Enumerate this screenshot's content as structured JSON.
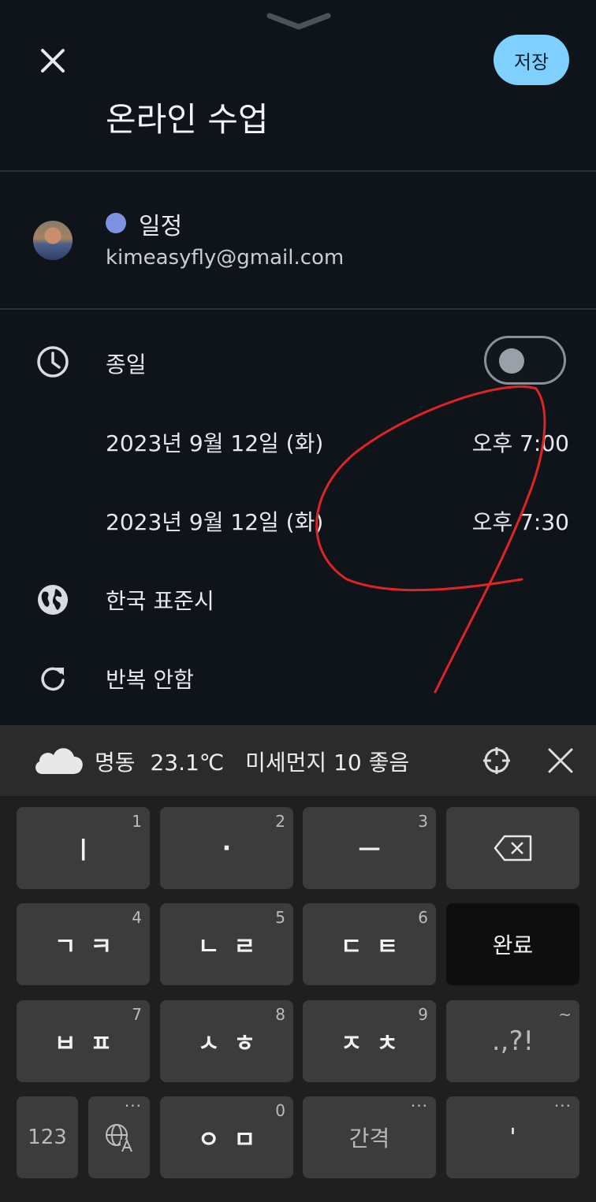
{
  "header": {
    "save_label": "저장",
    "event_title": "온라인 수업"
  },
  "calendar": {
    "name": "일정",
    "account": "kimeasyfly@gmail.com",
    "color": "#7b93e0"
  },
  "all_day": {
    "label": "종일",
    "enabled": false
  },
  "start": {
    "date": "2023년 9월 12일 (화)",
    "time": "오후 7:00"
  },
  "end": {
    "date": "2023년 9월 12일 (화)",
    "time": "오후 7:30"
  },
  "timezone": {
    "label": "한국 표준시"
  },
  "repeat": {
    "label": "반복 안함"
  },
  "weather": {
    "location": "명동",
    "temperature": "23.1℃",
    "air": "미세먼지 10 좋음"
  },
  "keyboard": {
    "row1": [
      {
        "label": "ㅣ",
        "num": "1"
      },
      {
        "label": "·",
        "num": "2"
      },
      {
        "label": "ㅡ",
        "num": "3"
      }
    ],
    "row2": [
      {
        "label": "ㄱㅋ",
        "num": "4"
      },
      {
        "label": "ㄴㄹ",
        "num": "5"
      },
      {
        "label": "ㄷㅌ",
        "num": "6"
      }
    ],
    "row3": [
      {
        "label": "ㅂㅍ",
        "num": "7"
      },
      {
        "label": "ㅅㅎ",
        "num": "8"
      },
      {
        "label": "ㅈㅊ",
        "num": "9"
      }
    ],
    "done_label": "완료",
    "punct_label": ".,?!",
    "punct_hint": "~",
    "mode_label": "123",
    "vowel_key": {
      "label": "ㅇㅁ",
      "num": "0"
    },
    "space_label": "간격",
    "apostrophe_label": "'",
    "more_hint": "···"
  },
  "icons": {
    "close": "close-icon",
    "clock": "clock-icon",
    "globe": "globe-icon",
    "repeat": "repeat-icon",
    "cloud": "cloud-icon",
    "locate": "crosshair-icon",
    "backspace": "backspace-icon",
    "language": "language-icon"
  }
}
